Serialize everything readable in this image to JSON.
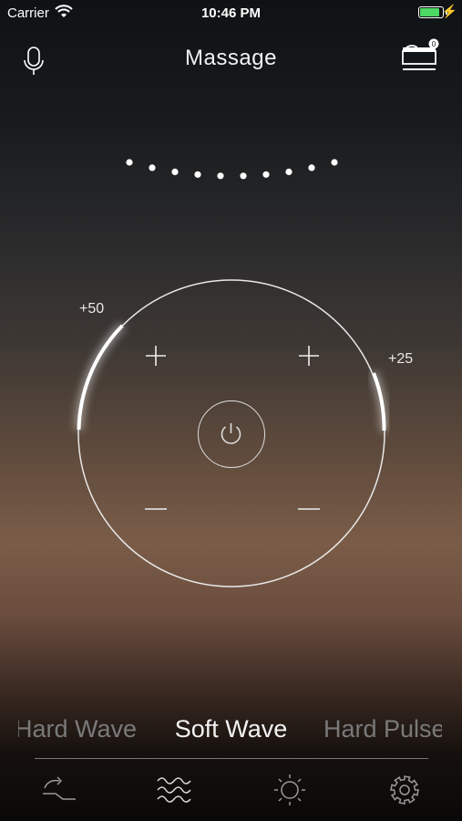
{
  "status_bar": {
    "carrier": "Carrier",
    "time": "10:46 PM",
    "battery_color": "#4cd964"
  },
  "header": {
    "title": "Massage",
    "mic_icon": "microphone-icon",
    "bed_icon": "bed-icon",
    "bed_badge": "0"
  },
  "intensity_indicator": {
    "left_level": "+50",
    "right_level": "+25",
    "dot_count": 10
  },
  "controls": {
    "plus_symbol": "+",
    "minus_symbol": "−",
    "power_icon": "power-icon"
  },
  "modes": {
    "previous": "Hard Wave",
    "current": "Soft Wave",
    "next": "Hard Pulse"
  },
  "tabbar": {
    "items": [
      {
        "icon": "bed-position-icon"
      },
      {
        "icon": "massage-wave-icon"
      },
      {
        "icon": "light-icon"
      },
      {
        "icon": "settings-icon"
      }
    ]
  }
}
